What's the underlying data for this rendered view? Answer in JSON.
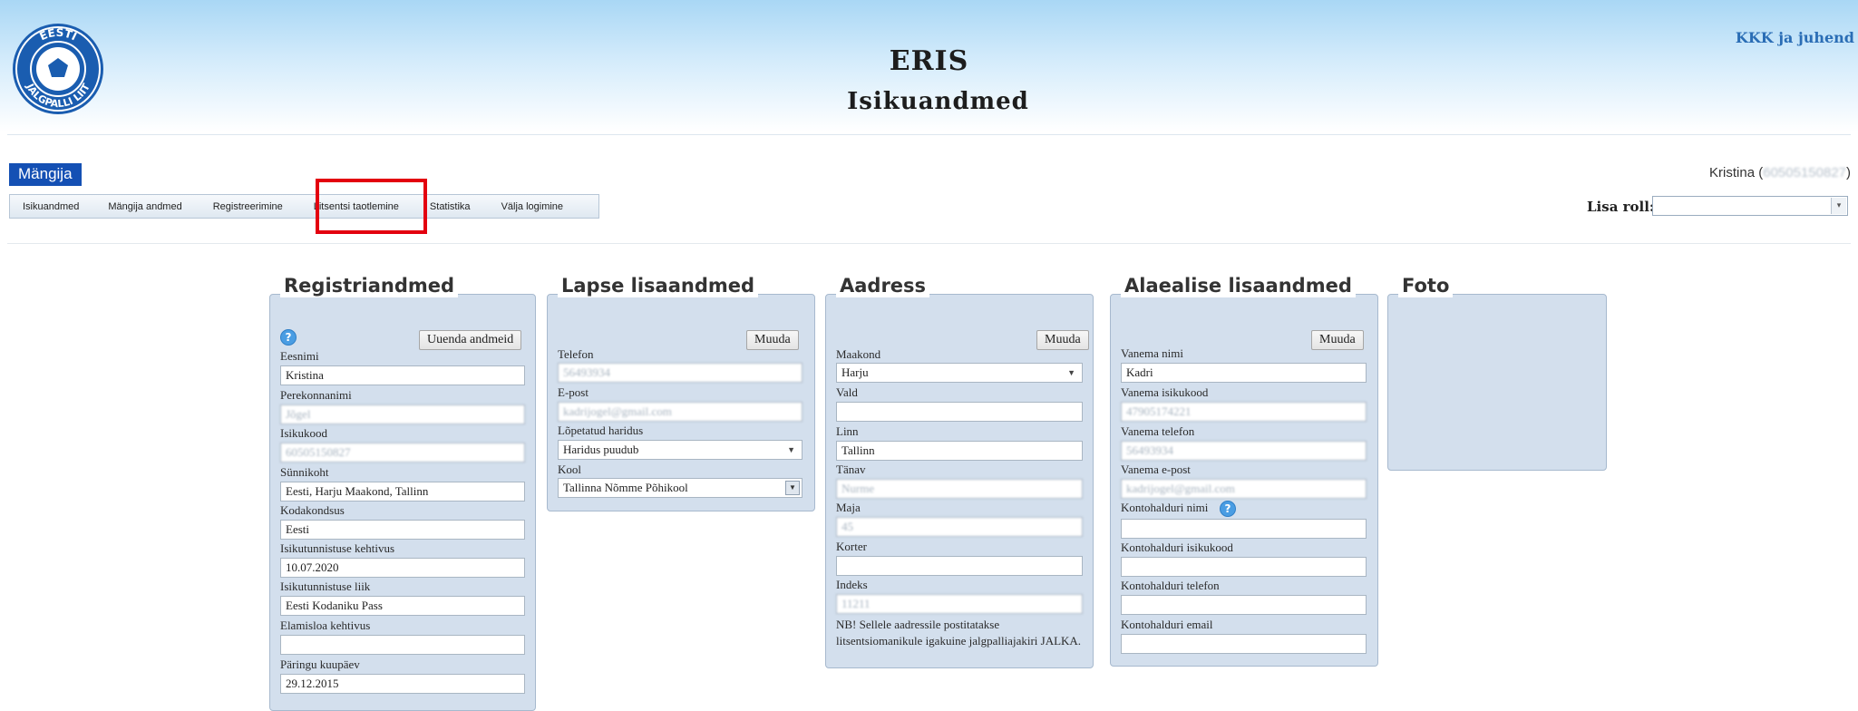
{
  "header": {
    "app_title": "ERIS",
    "page_title": "Isikuandmed",
    "help_link": "KKK ja juhend",
    "logo_text": "EESTI JALGPALLI LIIT"
  },
  "role_tab": "Mängija",
  "menu": [
    "Isikuandmed",
    "Mängija andmed",
    "Registreerimine",
    "Litsentsi taotlemine",
    "Statistika",
    "Välja logimine"
  ],
  "user": {
    "name": "Kristina",
    "id": "60505150827"
  },
  "add_role": {
    "label": "Lisa roll:",
    "value": ""
  },
  "registriandmed": {
    "title": "Registriandmed",
    "update_button": "Uuenda andmeid",
    "fields": [
      {
        "label": "Eesnimi",
        "value": "Kristina"
      },
      {
        "label": "Perekonnanimi",
        "value": "Jõgel"
      },
      {
        "label": "Isikukood",
        "value": "60505150827"
      },
      {
        "label": "Sünnikoht",
        "value": "Eesti, Harju Maakond, Tallinn"
      },
      {
        "label": "Kodakondsus",
        "value": "Eesti"
      },
      {
        "label": "Isikutunnistuse kehtivus",
        "value": "10.07.2020"
      },
      {
        "label": "Isikutunnistuse liik",
        "value": "Eesti Kodaniku Pass"
      },
      {
        "label": "Elamisloa kehtivus",
        "value": ""
      },
      {
        "label": "Päringu kuupäev",
        "value": "29.12.2015"
      }
    ]
  },
  "lapse": {
    "title": "Lapse lisaandmed",
    "edit_button": "Muuda",
    "telefon": {
      "label": "Telefon",
      "value": "56493934"
    },
    "epost": {
      "label": "E-post",
      "value": "kadrijogel@gmail.com"
    },
    "haridus": {
      "label": "Lõpetatud haridus",
      "value": "Haridus puudub"
    },
    "kool": {
      "label": "Kool",
      "value": "Tallinna Nõmme Põhikool"
    }
  },
  "aadress": {
    "title": "Aadress",
    "edit_button": "Muuda",
    "maakond": {
      "label": "Maakond",
      "value": "Harju"
    },
    "vald": {
      "label": "Vald",
      "value": ""
    },
    "linn": {
      "label": "Linn",
      "value": "Tallinn"
    },
    "tanav": {
      "label": "Tänav",
      "value": "Nurme"
    },
    "maja": {
      "label": "Maja",
      "value": "45"
    },
    "korter": {
      "label": "Korter",
      "value": ""
    },
    "indeks": {
      "label": "Indeks",
      "value": "11211"
    },
    "note_line1": "NB! Sellele aadressile postitatakse",
    "note_line2": "litsentsiomanikule igakuine jalgpalliajakiri JALKA."
  },
  "alaealise": {
    "title": "Alaealise lisaandmed",
    "edit_button": "Muuda",
    "vanema_nimi": {
      "label": "Vanema nimi",
      "value": "Kadri"
    },
    "vanema_isikukood": {
      "label": "Vanema isikukood",
      "value": "47905174221"
    },
    "vanema_telefon": {
      "label": "Vanema telefon",
      "value": "56493934"
    },
    "vanema_epost": {
      "label": "Vanema e-post",
      "value": "kadrijogel@gmail.com"
    },
    "kontohalduri_nimi": {
      "label": "Kontohalduri nimi",
      "value": ""
    },
    "kontohalduri_isikukood": {
      "label": "Kontohalduri isikukood",
      "value": ""
    },
    "kontohalduri_telefon": {
      "label": "Kontohalduri telefon",
      "value": ""
    },
    "kontohalduri_email": {
      "label": "Kontohalduri email",
      "value": ""
    }
  },
  "foto": {
    "title": "Foto"
  }
}
